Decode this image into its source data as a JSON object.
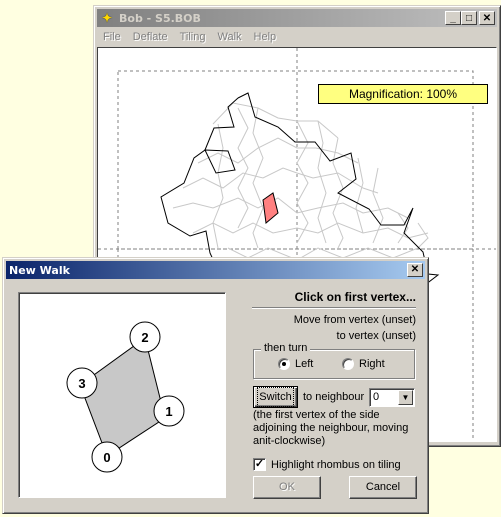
{
  "main_window": {
    "title": "Bob - S5.BOB",
    "icon": "bob-app-icon",
    "controls": {
      "minimize": "_",
      "maximize": "□",
      "close": "✕"
    },
    "menu": [
      {
        "label": "File",
        "hotkey": "F"
      },
      {
        "label": "Deflate",
        "hotkey": "D"
      },
      {
        "label": "Tiling",
        "hotkey": "T"
      },
      {
        "label": "Walk",
        "hotkey": "W"
      },
      {
        "label": "Help",
        "hotkey": "H"
      }
    ],
    "magnification_label": "Magnification: 100%",
    "colors": {
      "magnification_bg": "#ffff80",
      "highlight_rhombus": "#ff8080",
      "tile_lines": "#c0c0c0"
    }
  },
  "dialog": {
    "title": "New Walk",
    "close": "✕",
    "instruction": "Click on first vertex...",
    "move_from": "Move from vertex (unset)",
    "move_to": "to vertex (unset)",
    "turn_group": {
      "legend": "then turn",
      "left_label": "Left",
      "right_label": "Right",
      "selected": "Left"
    },
    "switch_label": "Switch",
    "to_neighbour_label": "to neighbour",
    "neighbour_value": "0",
    "note": "(the first vertex of the side adjoining the neighbour, moving anit-clockwise)",
    "highlight_label": "Highlight rhombus on tiling",
    "highlight_checked": true,
    "ok_label": "OK",
    "cancel_label": "Cancel",
    "preview": {
      "vertex_labels": [
        "0",
        "1",
        "2",
        "3"
      ],
      "fill": "#c8c8c8"
    }
  }
}
